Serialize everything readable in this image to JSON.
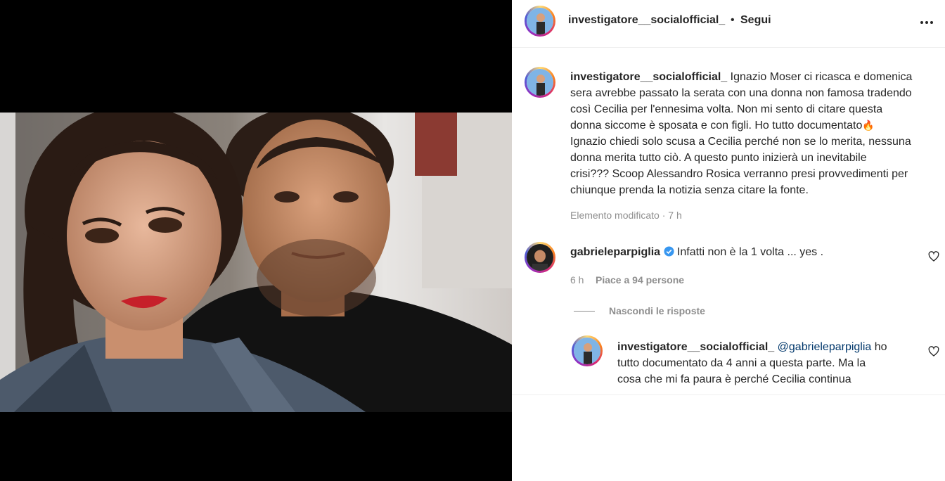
{
  "post": {
    "username": "investigatore__socialofficial_",
    "follow_separator": "•",
    "follow_label": "Segui",
    "more_icon": "more-horizontal-icon"
  },
  "caption": {
    "username": "investigatore__socialofficial_",
    "lines": [
      "Ignazio Moser ci ricasca e domenica",
      "sera avrebbe passato la serata con una donna non famosa tradendo",
      "così Cecilia per l'ennesima volta. Non mi sento di citare questa",
      "donna siccome è sposata e con figli. Ho tutto documentato",
      "Ignazio chiedi solo scusa a Cecilia perché non se lo merita, nessuna",
      "donna merita tutto ciò. A questo punto inizierà un inevitabile",
      "crisi??? Scoop Alessandro Rosica verranno presi provvedimenti per",
      "chiunque prenda la notizia senza citare la fonte."
    ],
    "emoji": "🔥",
    "meta": "Elemento modificato · 7 h"
  },
  "comment": {
    "username": "gabrieleparpiglia",
    "verified_icon": "verified-badge-icon",
    "text": "Infatti non è la 1 volta ... yes .",
    "time": "6 h",
    "likes": "Piace a 94 persone",
    "hide_replies": "Nascondi le risposte"
  },
  "reply": {
    "username": "investigatore__socialofficial_",
    "mention": "@gabrieleparpiglia",
    "line1_rest": "ho",
    "line2": "tutto documentato da 4 anni a questa parte. Ma la",
    "line3": "cosa che mi fa paura è perché Cecilia continua"
  },
  "colors": {
    "verified": "#3897f0",
    "mention": "#00376b",
    "muted": "#8e8e8e"
  }
}
